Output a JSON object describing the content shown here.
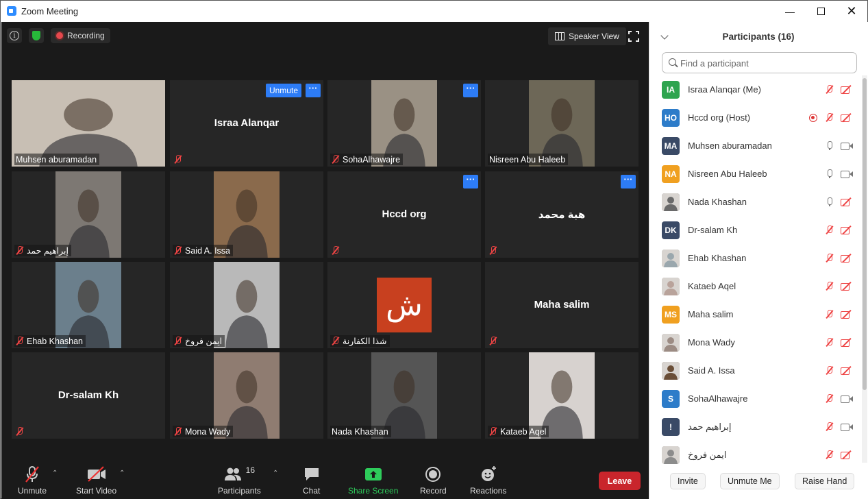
{
  "window": {
    "title": "Zoom Meeting"
  },
  "topbar": {
    "recording_label": "Recording",
    "speaker_view_label": "Speaker View"
  },
  "gallery": [
    {
      "name": "Muhsen aburamadan",
      "big_name": "",
      "video": "person",
      "bg": "#c8bfb4",
      "active": true,
      "muted": false,
      "unmute": false,
      "more": false
    },
    {
      "name": "",
      "big_name": "Israa Alanqar",
      "video": "",
      "bg": "#262626",
      "active": false,
      "muted": true,
      "unmute": true,
      "more": true
    },
    {
      "name": "SohaAlhawajre",
      "big_name": "",
      "video": "person",
      "bg": "#9a9184",
      "active": false,
      "muted": true,
      "unmute": false,
      "more": true
    },
    {
      "name": "Nisreen Abu Haleeb",
      "big_name": "",
      "video": "person",
      "bg": "#6d6757",
      "active": false,
      "muted": false,
      "unmute": false,
      "more": false
    },
    {
      "name": "إبراهيم حمد",
      "big_name": "",
      "video": "person",
      "bg": "#7d7873",
      "active": false,
      "muted": true,
      "unmute": false,
      "more": false
    },
    {
      "name": "Said A. Issa",
      "big_name": "",
      "video": "person",
      "bg": "#8a6a4c",
      "active": false,
      "muted": true,
      "unmute": false,
      "more": false
    },
    {
      "name": "",
      "big_name": "Hccd org",
      "video": "",
      "bg": "#262626",
      "active": false,
      "muted": true,
      "unmute": false,
      "more": true
    },
    {
      "name": "",
      "big_name": "هبة محمد",
      "video": "",
      "bg": "#262626",
      "active": false,
      "muted": true,
      "unmute": false,
      "more": true
    },
    {
      "name": "Ehab Khashan",
      "big_name": "",
      "video": "person",
      "bg": "#6b7f8c",
      "active": false,
      "muted": true,
      "unmute": false,
      "more": false
    },
    {
      "name": "ايمن فروخ",
      "big_name": "",
      "video": "person",
      "bg": "#b9b9b9",
      "active": false,
      "muted": true,
      "unmute": false,
      "more": false
    },
    {
      "name": "شذا الكفارنة",
      "big_name": "",
      "video": "logo",
      "logo_text": "ش",
      "bg": "#c8401f",
      "active": false,
      "muted": true,
      "unmute": false,
      "more": false
    },
    {
      "name": "",
      "big_name": "Maha salim",
      "video": "",
      "bg": "#262626",
      "active": false,
      "muted": true,
      "unmute": false,
      "more": false
    },
    {
      "name": "",
      "big_name": "Dr-salam Kh",
      "video": "",
      "bg": "#262626",
      "active": false,
      "muted": true,
      "unmute": false,
      "more": false
    },
    {
      "name": "Mona Wady",
      "big_name": "",
      "video": "person",
      "bg": "#8f7c71",
      "active": false,
      "muted": true,
      "unmute": false,
      "more": false
    },
    {
      "name": "Nada Khashan",
      "big_name": "",
      "video": "person",
      "bg": "#555555",
      "active": false,
      "muted": false,
      "unmute": false,
      "more": false
    },
    {
      "name": "Kataeb Aqel",
      "big_name": "",
      "video": "person",
      "bg": "#d7d2cf",
      "active": false,
      "muted": true,
      "unmute": false,
      "more": false
    }
  ],
  "tile_labels": {
    "unmute": "Unmute",
    "more": "···"
  },
  "toolbar": {
    "unmute": "Unmute",
    "start_video": "Start Video",
    "participants": "Participants",
    "participants_count": "16",
    "chat": "Chat",
    "share_screen": "Share Screen",
    "record": "Record",
    "reactions": "Reactions",
    "leave": "Leave"
  },
  "panel": {
    "title": "Participants (16)",
    "search_placeholder": "Find a participant",
    "participants": [
      {
        "initials": "IA",
        "color": "#2ea44f",
        "photo": false,
        "name": "Israa Alanqar (Me)",
        "recording": false,
        "mic": "off",
        "cam": "off"
      },
      {
        "initials": "HO",
        "color": "#2d7cc9",
        "photo": false,
        "name": "Hccd org (Host)",
        "recording": true,
        "mic": "off",
        "cam": "off"
      },
      {
        "initials": "MA",
        "color": "#3a4a66",
        "photo": false,
        "name": "Muhsen aburamadan",
        "recording": false,
        "mic": "on",
        "cam": "on"
      },
      {
        "initials": "NA",
        "color": "#f0a020",
        "photo": false,
        "name": "Nisreen Abu Haleeb",
        "recording": false,
        "mic": "on",
        "cam": "on"
      },
      {
        "initials": "",
        "color": "#6a6a6a",
        "photo": true,
        "name": "Nada Khashan",
        "recording": false,
        "mic": "on",
        "cam": "off"
      },
      {
        "initials": "DK",
        "color": "#3a4a66",
        "photo": false,
        "name": "Dr-salam Kh",
        "recording": false,
        "mic": "off",
        "cam": "off"
      },
      {
        "initials": "",
        "color": "#9aa7ad",
        "photo": true,
        "name": "Ehab Khashan",
        "recording": false,
        "mic": "off",
        "cam": "off"
      },
      {
        "initials": "",
        "color": "#b9a39b",
        "photo": true,
        "name": "Kataeb Aqel",
        "recording": false,
        "mic": "off",
        "cam": "off"
      },
      {
        "initials": "MS",
        "color": "#f0a020",
        "photo": false,
        "name": "Maha salim",
        "recording": false,
        "mic": "off",
        "cam": "off"
      },
      {
        "initials": "",
        "color": "#9c8c84",
        "photo": true,
        "name": "Mona Wady",
        "recording": false,
        "mic": "off",
        "cam": "off"
      },
      {
        "initials": "",
        "color": "#6a4e37",
        "photo": true,
        "name": "Said A. Issa",
        "recording": false,
        "mic": "off",
        "cam": "off"
      },
      {
        "initials": "S",
        "color": "#2d7cc9",
        "photo": false,
        "name": "SohaAlhawajre",
        "recording": false,
        "mic": "off",
        "cam": "on"
      },
      {
        "initials": "!",
        "color": "#3a4a66",
        "photo": false,
        "name": "إبراهيم حمد",
        "recording": false,
        "mic": "off",
        "cam": "on"
      },
      {
        "initials": "",
        "color": "#8c8c8c",
        "photo": true,
        "name": "ايمن فروخ",
        "recording": false,
        "mic": "off",
        "cam": "off"
      }
    ],
    "invite": "Invite",
    "unmute_me": "Unmute Me",
    "raise_hand": "Raise Hand"
  }
}
